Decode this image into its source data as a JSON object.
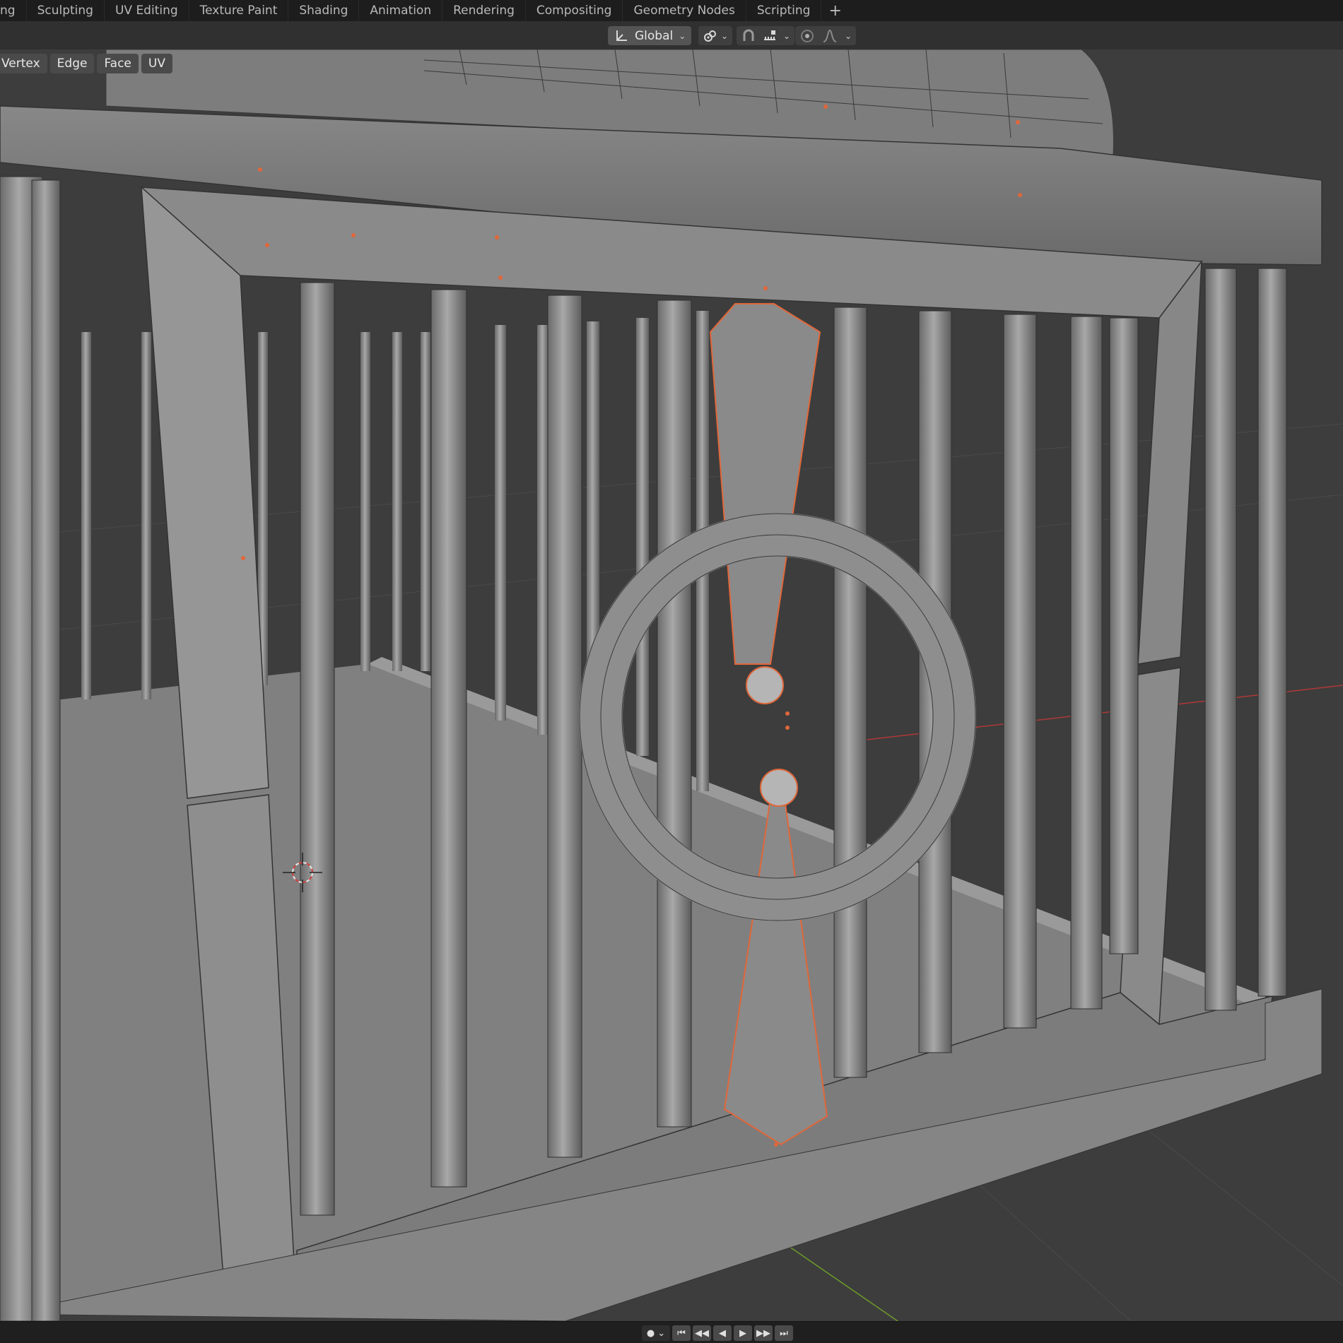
{
  "workspace_tabs": [
    {
      "label": "ng"
    },
    {
      "label": "Sculpting"
    },
    {
      "label": "UV Editing"
    },
    {
      "label": "Texture Paint"
    },
    {
      "label": "Shading"
    },
    {
      "label": "Animation"
    },
    {
      "label": "Rendering"
    },
    {
      "label": "Compositing"
    },
    {
      "label": "Geometry Nodes"
    },
    {
      "label": "Scripting"
    }
  ],
  "add_workspace_label": "+",
  "viewport_header": {
    "transform_orientation": "Global",
    "pivot_icon": "pivot-point-icon",
    "snap_icon": "magnet-snap-icon",
    "snap_target_icon": "snap-increment-icon",
    "proportional_icon": "proportional-edit-icon",
    "falloff_icon": "falloff-curve-icon"
  },
  "select_modes": [
    {
      "label": "Vertex"
    },
    {
      "label": "Edge"
    },
    {
      "label": "Face"
    },
    {
      "label": "UV"
    }
  ],
  "colors": {
    "selection_outline": "#e0673a",
    "grid_x_axis": "#b03838",
    "grid_y_axis": "#6e9a2a",
    "mesh_light": "#8c8c8c",
    "mesh_dark": "#4a4a4a",
    "background": "#3d3d3d"
  },
  "timeline": {
    "record_icon": "record-dot-icon",
    "buttons": [
      "⏮",
      "◀◀",
      "◀",
      "▶",
      "▶▶",
      "⏭"
    ]
  }
}
